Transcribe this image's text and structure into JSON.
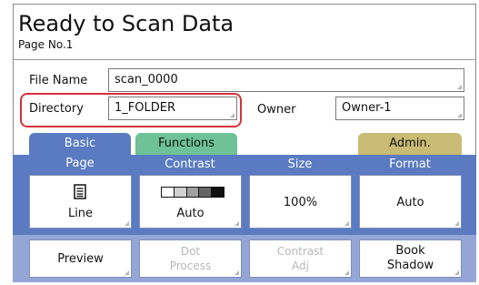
{
  "header": {
    "title": "Ready to Scan Data",
    "page_no": "Page No.1"
  },
  "fields": {
    "file_name_label": "File Name",
    "file_name_value": "scan_0000",
    "directory_label": "Directory",
    "directory_value": "1_FOLDER",
    "owner_label": "Owner",
    "owner_value": "Owner-1"
  },
  "tabs": {
    "basic": "Basic",
    "functions": "Functions",
    "admin": "Admin."
  },
  "columns": {
    "page": "Page",
    "contrast": "Contrast",
    "size": "Size",
    "format": "Format"
  },
  "buttons": {
    "page_value": "Line",
    "contrast_value": "Auto",
    "size_value": "100%",
    "format_value": "Auto",
    "preview": "Preview",
    "dot_process_1": "Dot",
    "dot_process_2": "Process",
    "contrast_adj_1": "Contrast",
    "contrast_adj_2": "Adj",
    "book_shadow_1": "Book",
    "book_shadow_2": "Shadow"
  },
  "icons": {
    "page_icon": "document-icon",
    "contrast_icon": "contrast-scale-icon"
  },
  "colors": {
    "tab_basic": "#5a7bc1",
    "tab_functions": "#6ec295",
    "tab_admin": "#c9bb74",
    "highlight": "#d6323a",
    "panel": "#5a7bc1",
    "panel_lower": "#93a6d5"
  }
}
